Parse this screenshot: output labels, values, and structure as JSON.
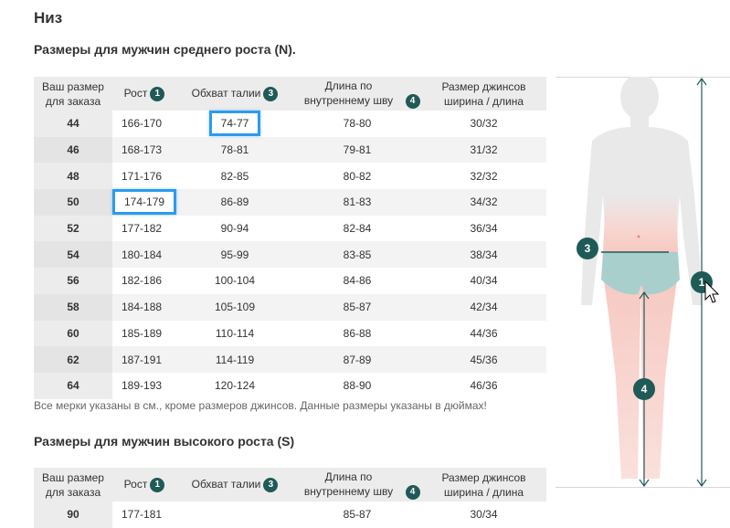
{
  "page": {
    "section_title": "Низ",
    "note": "Все мерки указаны в см., кроме размеров джинсов. Данные размеры указаны в дюймах!"
  },
  "table_regular": {
    "title": "Размеры для мужчин среднего роста (N).",
    "headers": {
      "order_size": "Ваш размер для заказа",
      "height": "Рост",
      "height_badge": "1",
      "waist": "Обхват талии",
      "waist_badge": "3",
      "inseam": "Длина по внутреннему шву",
      "inseam_badge": "4",
      "jeans": "Размер джинсов ширина / длина"
    },
    "rows": [
      {
        "size": "44",
        "height": "166-170",
        "waist": "74-77",
        "inseam": "78-80",
        "jeans": "30/32"
      },
      {
        "size": "46",
        "height": "168-173",
        "waist": "78-81",
        "inseam": "79-81",
        "jeans": "31/32"
      },
      {
        "size": "48",
        "height": "171-176",
        "waist": "82-85",
        "inseam": "80-82",
        "jeans": "32/32"
      },
      {
        "size": "50",
        "height": "174-179",
        "waist": "86-89",
        "inseam": "81-83",
        "jeans": "34/32"
      },
      {
        "size": "52",
        "height": "177-182",
        "waist": "90-94",
        "inseam": "82-84",
        "jeans": "36/34"
      },
      {
        "size": "54",
        "height": "180-184",
        "waist": "95-99",
        "inseam": "83-85",
        "jeans": "38/34"
      },
      {
        "size": "56",
        "height": "182-186",
        "waist": "100-104",
        "inseam": "84-86",
        "jeans": "40/34"
      },
      {
        "size": "58",
        "height": "184-188",
        "waist": "105-109",
        "inseam": "85-87",
        "jeans": "42/34"
      },
      {
        "size": "60",
        "height": "185-189",
        "waist": "110-114",
        "inseam": "86-88",
        "jeans": "44/36"
      },
      {
        "size": "62",
        "height": "187-191",
        "waist": "114-119",
        "inseam": "87-89",
        "jeans": "45/36"
      },
      {
        "size": "64",
        "height": "189-193",
        "waist": "120-124",
        "inseam": "88-90",
        "jeans": "46/36"
      }
    ]
  },
  "table_tall": {
    "title": "Размеры для мужчин высокого роста (S)",
    "headers": {
      "order_size": "Ваш размер для заказа",
      "height": "Рост",
      "height_badge": "1",
      "waist": "Обхват талии",
      "waist_badge": "3",
      "inseam": "Длина по внутреннему шву",
      "inseam_badge": "4",
      "jeans": "Размер джинсов ширина / длина"
    },
    "rows": [
      {
        "size": "90",
        "height": "177-181",
        "waist": "",
        "inseam": "85-87",
        "jeans": "30/34"
      }
    ]
  },
  "figure": {
    "badge_waist": "3",
    "badge_height": "1",
    "badge_inseam": "4",
    "colors": {
      "body": "#e8e8e8",
      "skin": "#f6c9c2",
      "shorts": "#a9cfcd",
      "accent": "#1f5a57",
      "highlight": "#2c9bf0"
    }
  }
}
